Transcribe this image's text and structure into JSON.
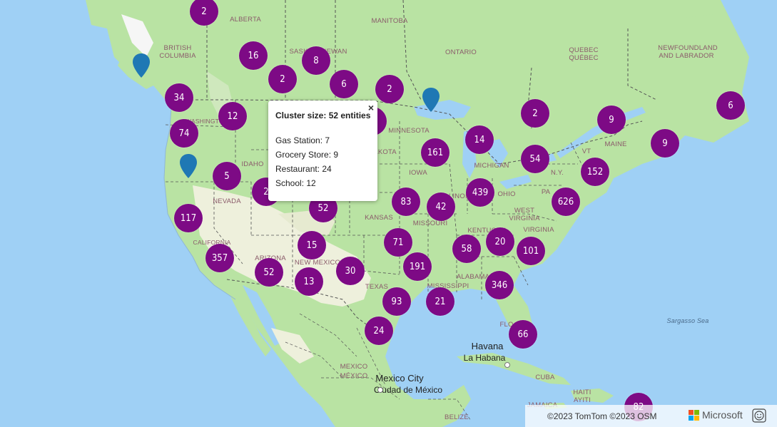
{
  "map": {
    "colors": {
      "water": "#9fd0f5",
      "land": "#b9e3a3",
      "arid": "#eef0dc",
      "cluster": "#7d0a85",
      "pin": "#1f78b4",
      "border": "#555555"
    },
    "region_labels": [
      {
        "text": "ALBERTA"
      },
      {
        "text": "MANITOBA"
      },
      {
        "text": "BRITISH"
      },
      {
        "text": "COLUMBIA"
      },
      {
        "text": "SASKATCHEWAN"
      },
      {
        "text": "ONTARIO"
      },
      {
        "text": "QUEBEC"
      },
      {
        "text": "QUÉBEC"
      },
      {
        "text": "NEWFOUNDLAND"
      },
      {
        "text": "AND LABRADOR"
      },
      {
        "text": "WASHINGTON"
      },
      {
        "text": "IDAHO"
      },
      {
        "text": "NEVADA"
      },
      {
        "text": "CALIFORNIA"
      },
      {
        "text": "ARIZONA"
      },
      {
        "text": "NEW MEXICO"
      },
      {
        "text": "TEXAS"
      },
      {
        "text": "KANSAS"
      },
      {
        "text": "MINNESOTA"
      },
      {
        "text": "IOWA"
      },
      {
        "text": "MISSOURI"
      },
      {
        "text": "MICHIGAN"
      },
      {
        "text": "OHIO"
      },
      {
        "text": "ILLINOIS"
      },
      {
        "text": "KENTUCKY"
      },
      {
        "text": "WEST"
      },
      {
        "text": "VIRGINIA"
      },
      {
        "text": "VIRGINIA"
      },
      {
        "text": "PA"
      },
      {
        "text": "N.Y."
      },
      {
        "text": "VT"
      },
      {
        "text": "MAINE"
      },
      {
        "text": "ALABAMA"
      },
      {
        "text": "MISSISSIPPI"
      },
      {
        "text": "FLO"
      },
      {
        "text": "MEXICO"
      },
      {
        "text": "MÉXICO"
      },
      {
        "text": "CUBA"
      },
      {
        "text": "HAITI"
      },
      {
        "text": "AYITI"
      },
      {
        "text": "JAMAICA"
      },
      {
        "text": "BELIZE"
      },
      {
        "text": "Sargasso Sea"
      },
      {
        "text": "DAKOTA"
      }
    ],
    "cities": [
      {
        "name": "Havana"
      },
      {
        "name": "La Habana"
      },
      {
        "name": "Mexico City"
      },
      {
        "name": "Ciudad de México"
      }
    ],
    "clusters": [
      "2",
      "16",
      "2",
      "8",
      "6",
      "2",
      "34",
      "12",
      "74",
      "5",
      "117",
      "357",
      "52",
      "13",
      "15",
      "30",
      "52",
      "2",
      "83",
      "42",
      "71",
      "191",
      "93",
      "21",
      "24",
      "161",
      "14",
      "439",
      "58",
      "20",
      "101",
      "346",
      "66",
      "54",
      "152",
      "626",
      "2",
      "9",
      "6",
      "9",
      "82"
    ],
    "pins": [
      "pin-bc",
      "pin-oregon",
      "pin-ontario"
    ]
  },
  "popup": {
    "title": "Cluster size: 52 entities",
    "close": "×",
    "rows": [
      "Gas Station: 7",
      "Grocery Store: 9",
      "Restaurant: 24",
      "School: 12"
    ]
  },
  "attribution": {
    "copyright": "©2023 TomTom  ©2023 OSM",
    "brand": "Microsoft",
    "feedback_icon": "smiley-feedback-icon"
  }
}
